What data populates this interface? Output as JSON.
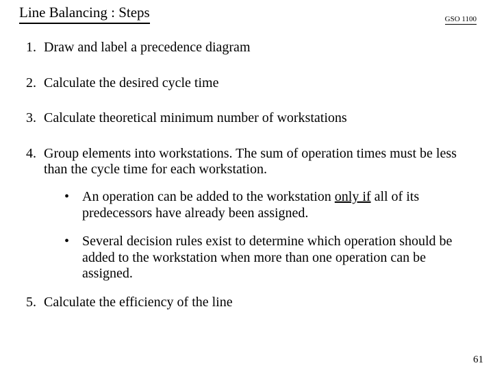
{
  "header": {
    "title": "Line Balancing : Steps",
    "course_code": "GSO 1100"
  },
  "steps": {
    "s1": "Draw and label a precedence diagram",
    "s2": "Calculate the desired cycle time",
    "s3": "Calculate theoretical minimum number of workstations",
    "s4": "Group elements into workstations. The sum of operation times must be less than the cycle time for each workstation.",
    "s4_bullets": {
      "b1_pre": "An operation can be added to the workstation ",
      "b1_under": "only if",
      "b1_post": " all of its predecessors have already been assigned.",
      "b2": "Several decision rules exist to determine which operation should be added to the workstation when more than one operation can be assigned."
    },
    "s5": "Calculate the efficiency of the line"
  },
  "page_number": "61"
}
